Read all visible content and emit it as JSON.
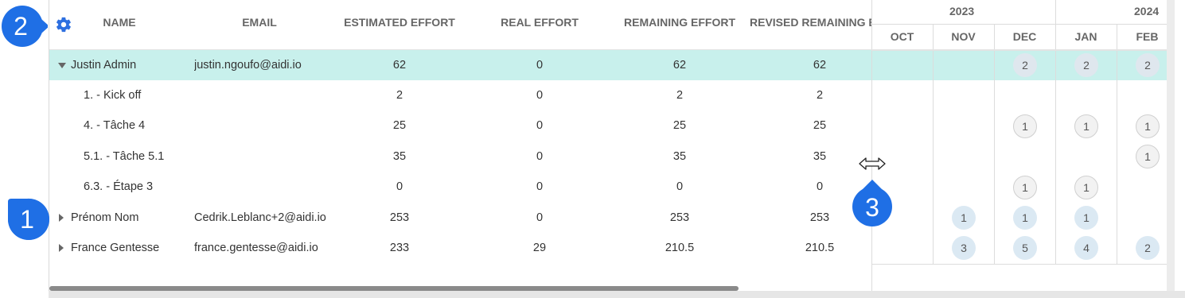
{
  "header": {
    "name": "NAME",
    "email": "EMAIL",
    "estimated_effort": "ESTIMATED EFFORT",
    "real_effort": "REAL EFFORT",
    "remaining_effort": "REMAINING EFFORT",
    "revised_remaining": "REVISED REMAINING E"
  },
  "rows": [
    {
      "name": "Justin Admin",
      "email": "justin.ngoufo@aidi.io",
      "estimated": "62",
      "real": "0",
      "remaining": "62",
      "revised": "62"
    },
    {
      "name": "1. - Kick off",
      "email": "",
      "estimated": "2",
      "real": "0",
      "remaining": "2",
      "revised": "2"
    },
    {
      "name": "4. - Tâche 4",
      "email": "",
      "estimated": "25",
      "real": "0",
      "remaining": "25",
      "revised": "25"
    },
    {
      "name": "5.1. - Tâche 5.1",
      "email": "",
      "estimated": "35",
      "real": "0",
      "remaining": "35",
      "revised": "35"
    },
    {
      "name": "6.3. - Étape 3",
      "email": "",
      "estimated": "0",
      "real": "0",
      "remaining": "0",
      "revised": "0"
    },
    {
      "name": "Prénom Nom",
      "email": "Cedrik.Leblanc+2@aidi.io",
      "estimated": "253",
      "real": "0",
      "remaining": "253",
      "revised": "253"
    },
    {
      "name": "France Gentesse",
      "email": "france.gentesse@aidi.io",
      "estimated": "233",
      "real": "29",
      "remaining": "210.5",
      "revised": "210.5"
    }
  ],
  "gantt": {
    "years": [
      "2023",
      "2024"
    ],
    "months": [
      "OCT",
      "NOV",
      "DEC",
      "JAN",
      "FEB"
    ],
    "row0": {
      "dec": "2",
      "jan": "2",
      "feb": "2"
    },
    "row2": {
      "dec": "1",
      "jan": "1",
      "feb": "1"
    },
    "row3": {
      "feb": "1"
    },
    "row4": {
      "dec": "1",
      "jan": "1"
    },
    "row5": {
      "nov": "1",
      "dec": "1",
      "jan": "1"
    },
    "row6": {
      "nov": "3",
      "dec": "5",
      "jan": "4",
      "feb": "2"
    }
  },
  "markers": {
    "m1": "1",
    "m2": "2",
    "m3": "3"
  },
  "colors": {
    "highlight": "#c8f0ec",
    "accent": "#2d6fe0",
    "marker": "#1f6fe5"
  },
  "icons": {
    "settings": "gear-icon",
    "resize": "resize-horizontal-icon",
    "expand": "caret-icon"
  }
}
